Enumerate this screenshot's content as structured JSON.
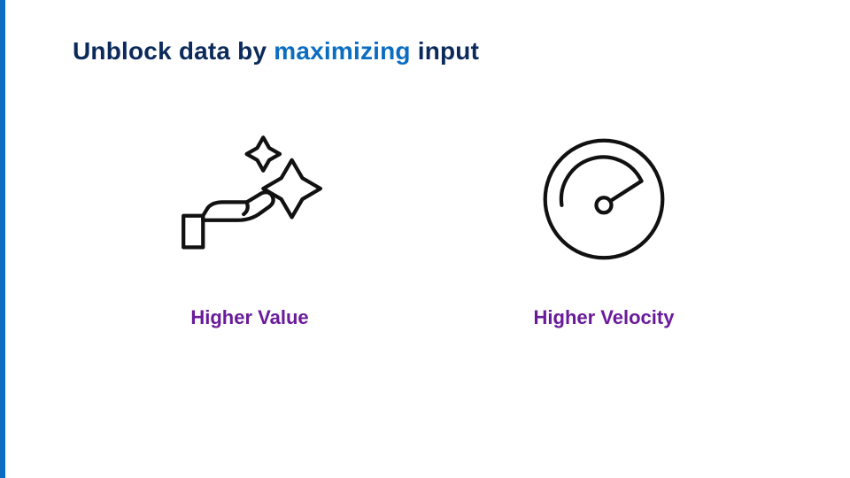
{
  "colors": {
    "title": "#0b2a5b",
    "accent": "#0a6dc2",
    "caption": "#6a1b9a",
    "icon_stroke": "#111111"
  },
  "title": {
    "prefix": "Unblock data by ",
    "highlight": "maximizing",
    "suffix": " input"
  },
  "cards": [
    {
      "icon": "hand-sparkle-icon",
      "caption": "Higher Value"
    },
    {
      "icon": "gauge-icon",
      "caption": "Higher Velocity"
    }
  ]
}
